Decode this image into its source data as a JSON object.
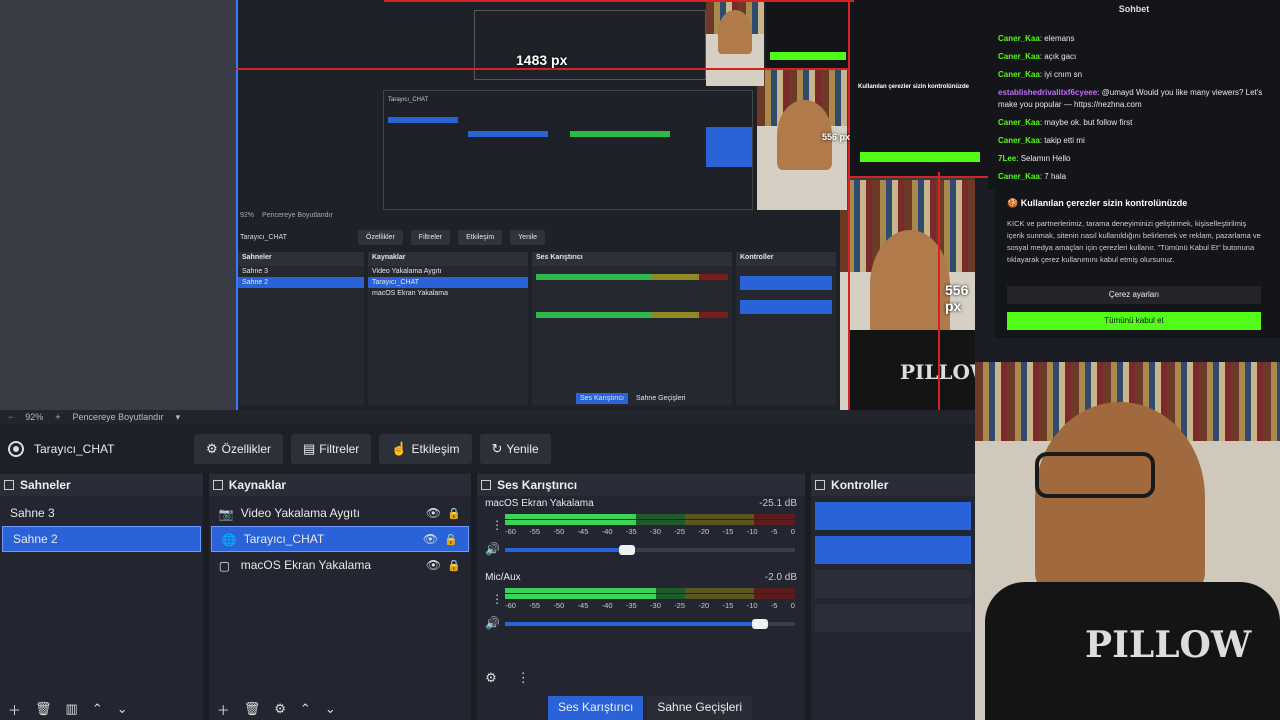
{
  "nested_preview": {
    "px_label_top": "1483 px",
    "px_label_mid": "556 px",
    "px_label_right": "556 px",
    "zoom": "92%",
    "fit_label": "Pencereye Boyutlandır",
    "source_title": "Tarayıcı_CHAT",
    "buttons": [
      "Özellikler",
      "Filtreler",
      "Etkileşim",
      "Yenile"
    ],
    "scenes_title": "Sahneler",
    "scenes": [
      "Sahne 3",
      "Sahne 2"
    ],
    "sources_title": "Kaynaklar",
    "sources": [
      "Video Yakalama Aygıtı",
      "Tarayıcı_CHAT",
      "macOS Ekran Yakalama"
    ],
    "mixer_title": "Ses Karıştırıcı",
    "controls_title": "Kontroller",
    "tab_mixer": "Ses Karıştırıcı",
    "tab_transitions": "Sahne Geçişleri"
  },
  "chat": {
    "title": "Sohbet",
    "messages": [
      {
        "user": "Caner_Kaa",
        "text": "elemans"
      },
      {
        "user": "Caner_Kaa",
        "text": "açık gacı"
      },
      {
        "user": "Caner_Kaa",
        "text": "iyi cnım sn"
      },
      {
        "user": "establishedrivalitxf6cyeee",
        "text": "@umayd Would you like many viewers? Let's make you popular — https://nezhna.com"
      },
      {
        "user": "Caner_Kaa",
        "text": "maybe ok. but follow first"
      },
      {
        "user": "Caner_Kaa",
        "text": "takip etti mi"
      },
      {
        "user": "7Lee",
        "text": "Selamın Hello"
      },
      {
        "user": "Caner_Kaa",
        "text": "7 hala"
      }
    ]
  },
  "cookie": {
    "title": "Kullanılan çerezler sizin kontrolünüzde",
    "body": "KICK ve partnerlerimiz, tarama deneyiminizi geliştirmek, kişiselleştirilmiş içerik sunmak, sitenin nasıl kullanıldığını belirlemek ve reklam, pazarlama ve sosyal medya amaçları için çerezleri kullanır. \"Tümünü Kabul Et\" butonuna tıklayarak çerez kullanımını kabul etmiş olursunuz.",
    "settings_button": "Çerez ayarları",
    "accept_button": "Tümünü kabul et"
  },
  "obs": {
    "zoom": "92%",
    "fit_label": "Pencereye Boyutlandır",
    "source_title": "Tarayıcı_CHAT",
    "toolbar": {
      "properties": "Özellikler",
      "filters": "Filtreler",
      "interact": "Etkileşim",
      "refresh": "Yenile"
    },
    "scenes": {
      "title": "Sahneler",
      "items": [
        "Sahne 3",
        "Sahne 2"
      ],
      "selected": "Sahne 2"
    },
    "sources": {
      "title": "Kaynaklar",
      "items": [
        "Video Yakalama Aygıtı",
        "Tarayıcı_CHAT",
        "macOS Ekran Yakalama"
      ],
      "selected": "Tarayıcı_CHAT"
    },
    "mixer": {
      "title": "Ses Karıştırıcı",
      "scale": [
        "-60",
        "-55",
        "-50",
        "-45",
        "-40",
        "-35",
        "-30",
        "-25",
        "-20",
        "-15",
        "-10",
        "-5",
        "0"
      ],
      "channels": [
        {
          "name": "macOS Ekran Yakalama",
          "db": "-25.1 dB",
          "volume": 0.42,
          "level": 0.45
        },
        {
          "name": "Mic/Aux",
          "db": "-2.0 dB",
          "volume": 0.88,
          "level": 0.52
        }
      ],
      "tab_mixer": "Ses Karıştırıcı",
      "tab_transitions": "Sahne Geçişleri"
    },
    "controls": {
      "title": "Kontroller"
    }
  },
  "webcam": {
    "shirt_text": "PILLOW"
  },
  "colors": {
    "accent_blue": "#2a63d7",
    "kick_green": "#53fc18",
    "guide_red": "#d52222"
  }
}
